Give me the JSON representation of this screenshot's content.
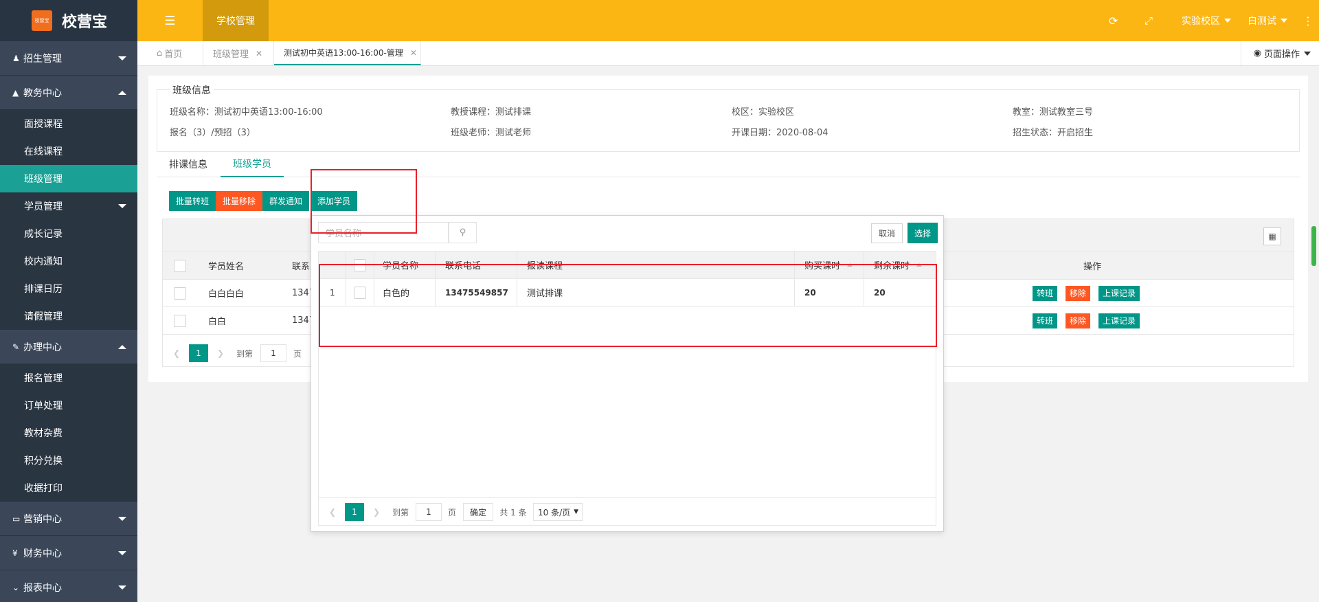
{
  "app": {
    "logo_mark": "校营宝",
    "name": "校营宝"
  },
  "header": {
    "module_tab": "学校管理",
    "campus": "实验校区",
    "user": "白测试"
  },
  "sidebar": {
    "groups": [
      {
        "label": "招生管理",
        "icon": "user-plus-icon"
      },
      {
        "label": "教务中心",
        "icon": "graduation-cap-icon"
      },
      {
        "label": "办理中心",
        "icon": "edit-icon"
      },
      {
        "label": "营销中心",
        "icon": "laptop-icon"
      },
      {
        "label": "财务中心",
        "icon": "yen-icon"
      },
      {
        "label": "报表中心",
        "icon": "chart-icon"
      }
    ],
    "academic_items": [
      "面授课程",
      "在线课程",
      "班级管理",
      "学员管理",
      "成长记录",
      "校内通知",
      "排课日历",
      "请假管理"
    ],
    "office_items": [
      "报名管理",
      "订单处理",
      "教材杂费",
      "积分兑换",
      "收据打印"
    ]
  },
  "tabs": {
    "home": "首页",
    "class_mgmt": "班级管理",
    "current": "测试初中英语13:00-16:00-管理",
    "page_ops": "页面操作"
  },
  "class_info": {
    "legend": "班级信息",
    "name": "班级名称：测试初中英语13:00-16:00",
    "course": "教授课程：测试排课",
    "campus": "校区：实验校区",
    "room": "教室：测试教室三号",
    "enroll": "报名（3）/预招（3）",
    "teacher": "班级老师：测试老师",
    "start_date": "开课日期：2020-08-04",
    "status": "招生状态：开启招生"
  },
  "content_tabs": [
    "排课信息",
    "班级学员"
  ],
  "actions": {
    "batch_transfer": "批量转班",
    "batch_remove": "批量移除",
    "group_notify": "群发通知",
    "add_student": "添加学员"
  },
  "members_table": {
    "headers": {
      "name": "学员姓名",
      "phone": "联系",
      "ops": "操作"
    },
    "rows": [
      {
        "name": "白白白白",
        "phone": "1347"
      },
      {
        "name": "白白",
        "phone": "1347"
      }
    ],
    "row_buttons": {
      "transfer": "转班",
      "remove": "移除",
      "records": "上课记录"
    },
    "pager": {
      "current": "1",
      "goto": "到第",
      "input": "1",
      "page": "页"
    }
  },
  "dialog": {
    "search_placeholder": "学员名称",
    "cancel": "取消",
    "select": "选择",
    "headers": [
      "学员名称",
      "联系电话",
      "报读课程",
      "购买课时",
      "剩余课时"
    ],
    "rows": [
      {
        "index": "1",
        "name": "白色的",
        "phone": "13475549857",
        "course": "测试排课",
        "bought": "20",
        "remaining": "20"
      }
    ],
    "pager": {
      "current": "1",
      "goto": "到第",
      "input": "1",
      "page": "页",
      "confirm": "确定",
      "total": "共 1 条",
      "per_page": "10 条/页"
    }
  },
  "colors": {
    "header": "#fcb613",
    "sidebar": "#2f3b4b",
    "accent": "#009688",
    "danger": "#ff5722",
    "highlight": "#e8202a"
  }
}
